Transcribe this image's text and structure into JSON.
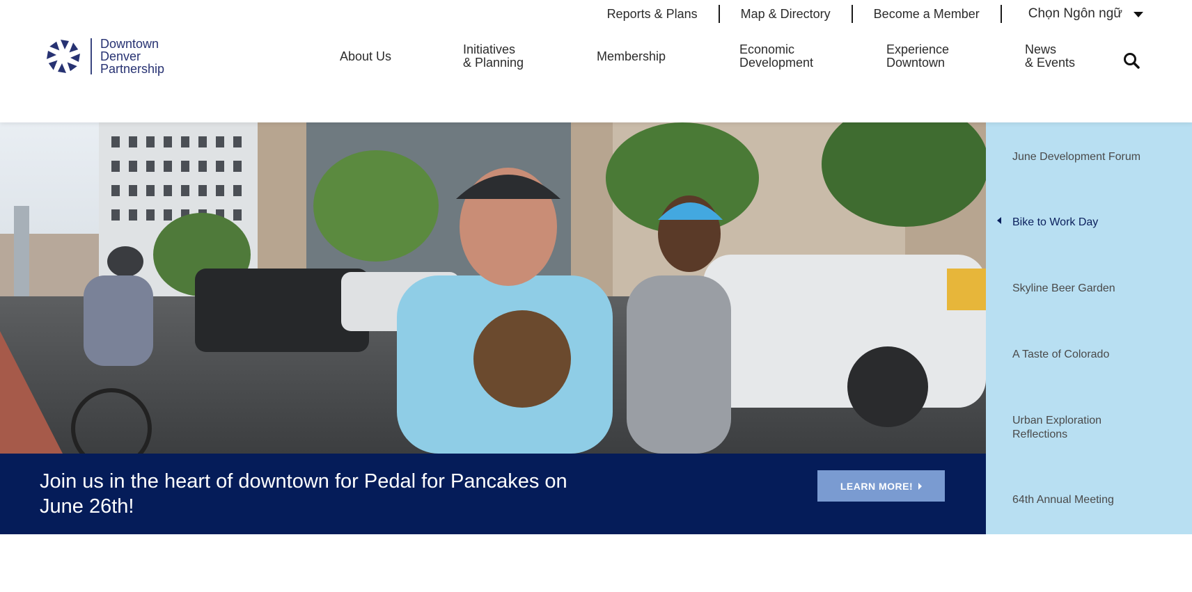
{
  "utility": {
    "links": [
      "Reports & Plans",
      "Map & Directory",
      "Become a Member"
    ],
    "language": "Chọn Ngôn ngữ"
  },
  "logo": {
    "line1": "Downtown",
    "line2": "Denver",
    "line3": "Partnership"
  },
  "nav": {
    "items": [
      "About Us",
      "Initiatives\n& Planning",
      "Membership",
      "Economic\nDevelopment",
      "Experience\nDowntown",
      "News\n& Events"
    ]
  },
  "hero": {
    "banner_text": "Join us in the heart of downtown for Pedal for Pancakes on June 26th!",
    "button_label": "LEARN MORE!"
  },
  "side_list": {
    "items": [
      "June Development Forum",
      "Bike to Work Day",
      "Skyline Beer Garden",
      "A Taste of Colorado",
      "Urban Exploration\nReflections",
      "64th Annual Meeting"
    ],
    "active_index": 1
  },
  "colors": {
    "brand_navy": "#051c59",
    "logo_navy": "#273272",
    "button_blue": "#7a9bd1",
    "side_bg": "#b8dff2"
  }
}
